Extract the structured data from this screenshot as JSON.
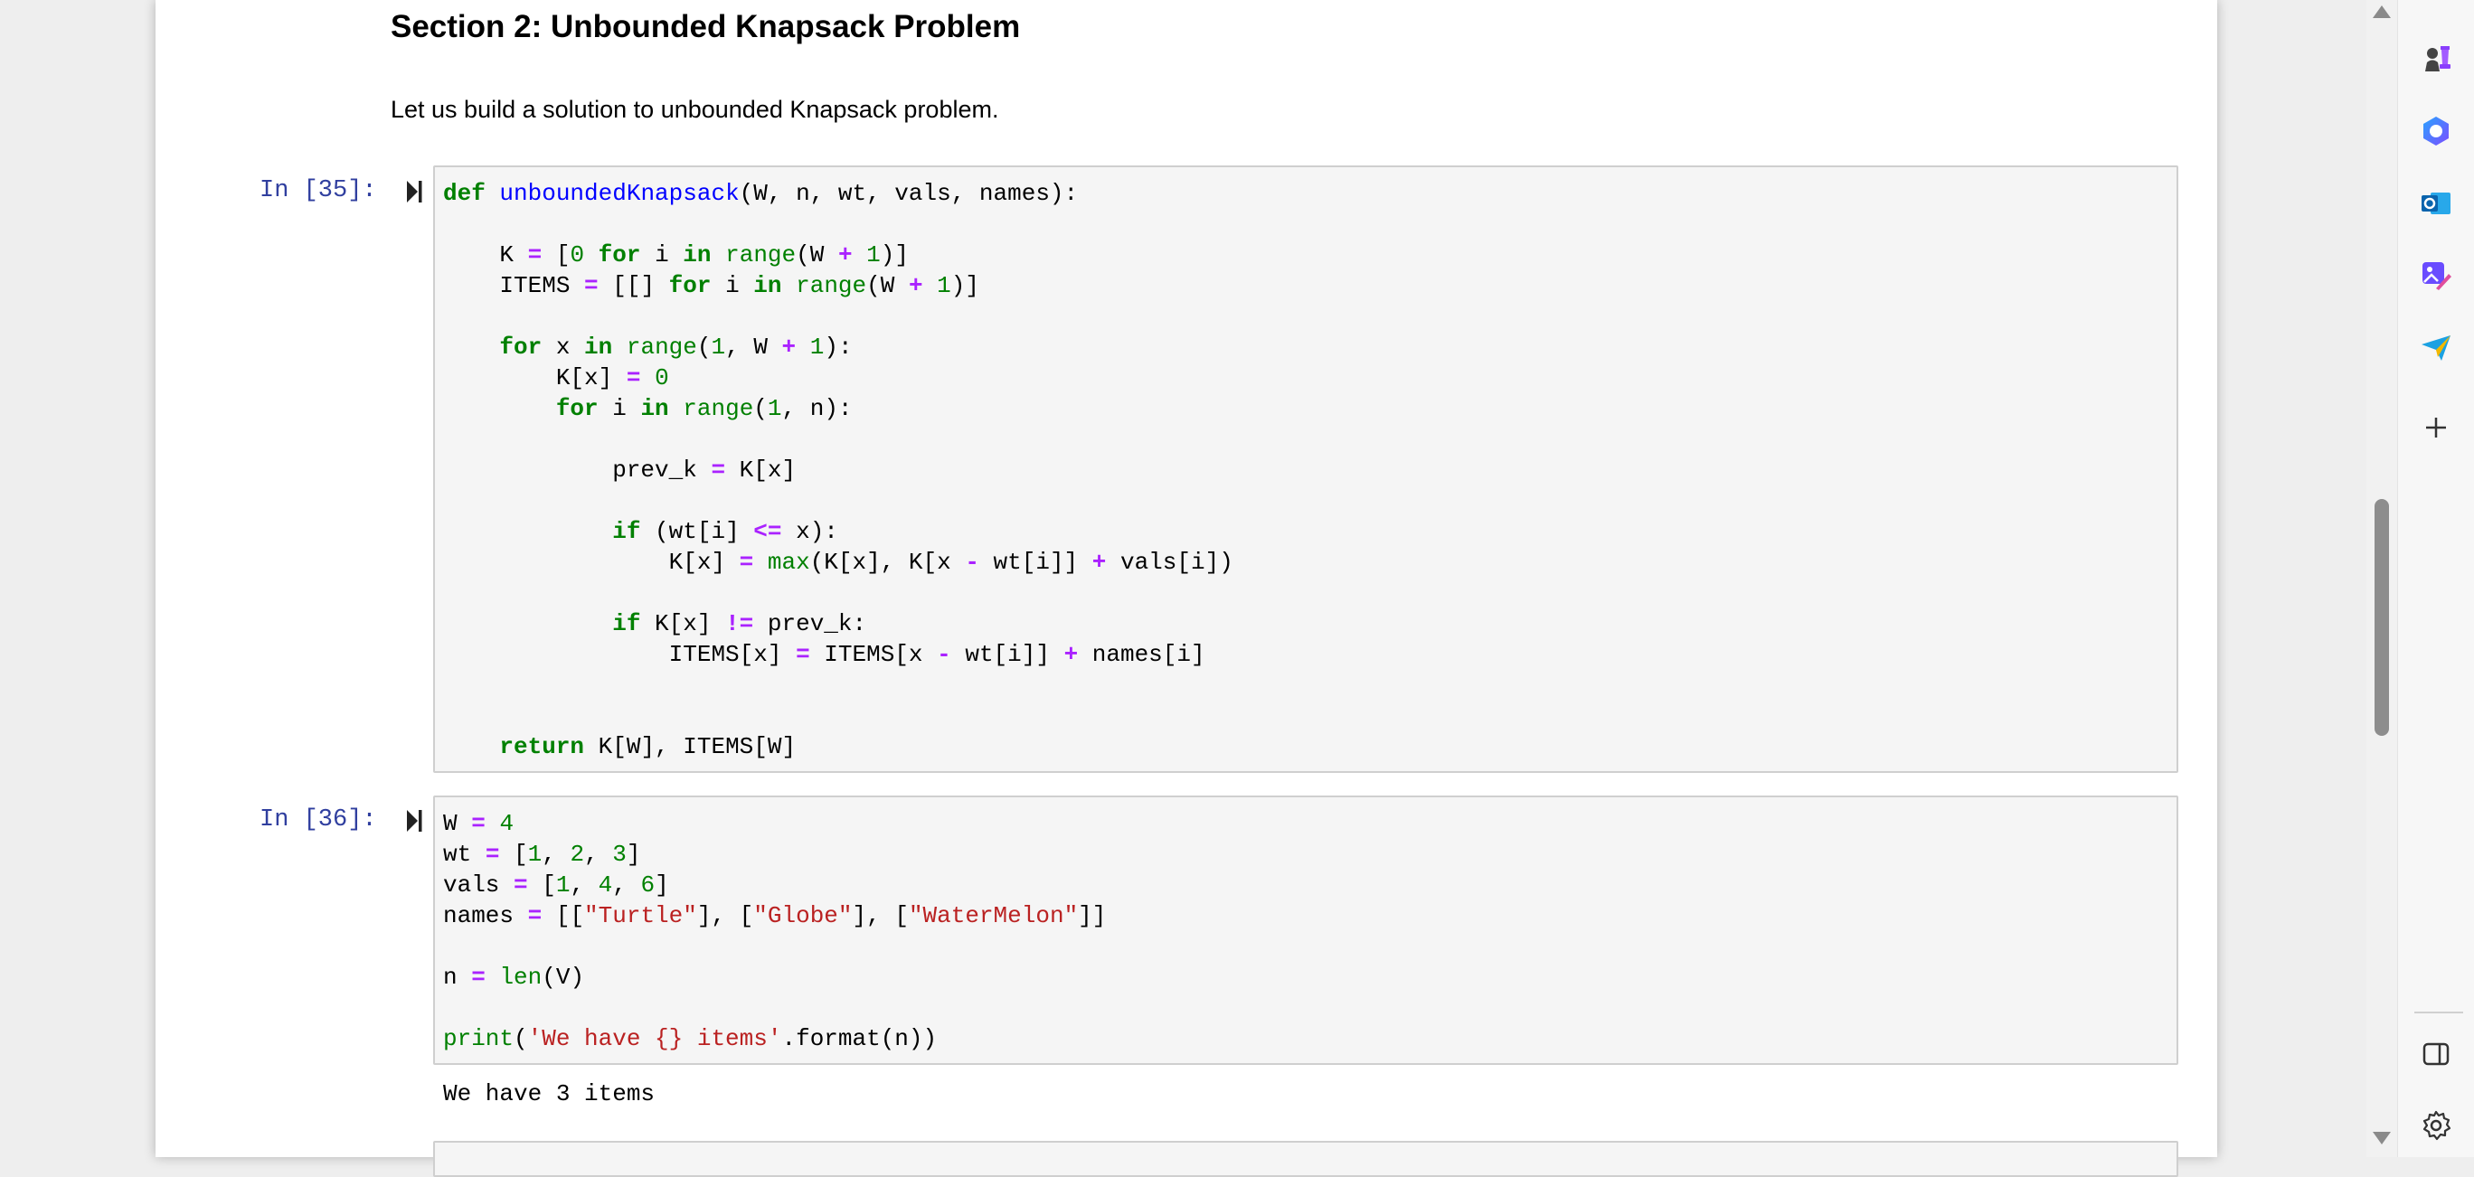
{
  "section": {
    "title": "Section 2: Unbounded Knapsack Problem",
    "intro": "Let us build a solution to unbounded Knapsack problem."
  },
  "cells": [
    {
      "prompt": "In [35]:",
      "code_lines": [
        "def unboundedKnapsack(W, n, wt, vals, names):",
        "",
        "    K = [0 for i in range(W + 1)]",
        "    ITEMS = [[] for i in range(W + 1)]",
        "",
        "    for x in range(1, W + 1):",
        "        K[x] = 0",
        "        for i in range(1, n):",
        "",
        "            prev_k = K[x]",
        "",
        "            if (wt[i] <= x):",
        "                K[x] = max(K[x], K[x - wt[i]] + vals[i])",
        "",
        "            if K[x] != prev_k:",
        "                ITEMS[x] = ITEMS[x - wt[i]] + names[i]",
        "",
        "",
        "    return K[W], ITEMS[W]"
      ]
    },
    {
      "prompt": "In [36]:",
      "code_lines": [
        "W = 4",
        "wt = [1, 2, 3]",
        "vals = [1, 4, 6]",
        "names = [[\"Turtle\"], [\"Globe\"], [\"WaterMelon\"]]",
        "",
        "n = len(V)",
        "",
        "print('We have {} items'.format(n))"
      ],
      "output": "We have 3 items"
    }
  ],
  "colors": {
    "keyword": "#008000",
    "function_name": "#0000ff",
    "operator": "#aa22ff",
    "string": "#ba2121",
    "prompt": "#303f9f",
    "cell_background": "#f5f5f5"
  },
  "sidebar_icons": [
    "chess-icon",
    "copilot-icon",
    "outlook-icon",
    "designer-icon",
    "send-icon",
    "add-icon",
    "sidebar-toggle-icon",
    "settings-icon"
  ]
}
